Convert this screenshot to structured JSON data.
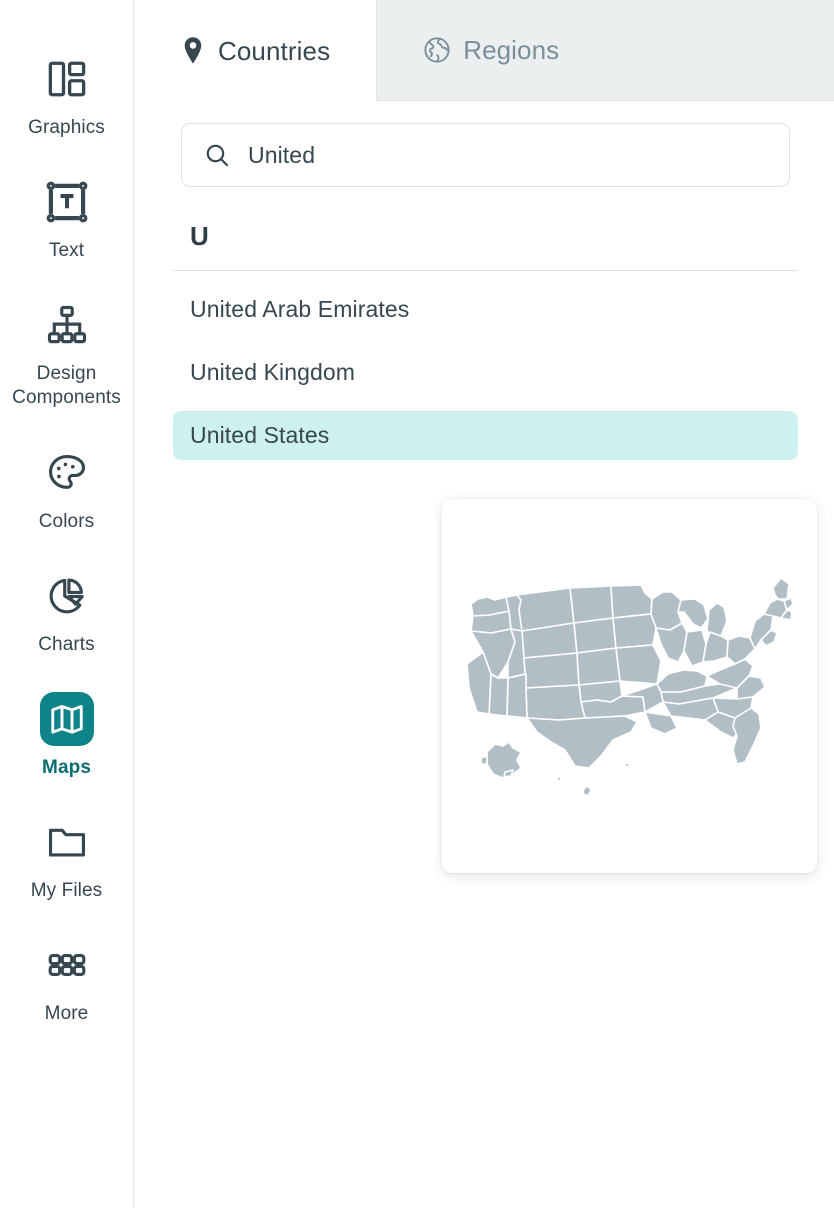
{
  "sidebar": {
    "items": [
      {
        "label": "Graphics",
        "icon": "graphics-layout-icon",
        "active": false
      },
      {
        "label": "Text",
        "icon": "text-frame-icon",
        "active": false
      },
      {
        "label": "Design Components",
        "icon": "design-components-hierarchy-icon",
        "active": false
      },
      {
        "label": "Colors",
        "icon": "color-palette-icon",
        "active": false
      },
      {
        "label": "Charts",
        "icon": "pie-chart-icon",
        "active": false
      },
      {
        "label": "Maps",
        "icon": "folded-map-icon",
        "active": true
      },
      {
        "label": "My Files",
        "icon": "folder-icon",
        "active": false
      },
      {
        "label": "More",
        "icon": "grid-dots-icon",
        "active": false
      }
    ],
    "active_accent": "#0e8488",
    "active_label_color": "#0b6d70"
  },
  "tabs": [
    {
      "label": "Countries",
      "icon": "map-pin-icon",
      "active": true
    },
    {
      "label": "Regions",
      "icon": "globe-icon",
      "active": false
    }
  ],
  "search": {
    "value": "United",
    "placeholder": "Search",
    "icon": "search-icon"
  },
  "results": {
    "group_letter": "U",
    "items": [
      {
        "label": "United Arab Emirates",
        "selected": false
      },
      {
        "label": "United Kingdom",
        "selected": false
      },
      {
        "label": "United States",
        "selected": true
      }
    ],
    "selected_bg": "#cdf1ef"
  },
  "preview": {
    "name": "united-states-map-thumbnail",
    "fill_color": "#b2bec6",
    "stroke_color": "#ffffff"
  }
}
